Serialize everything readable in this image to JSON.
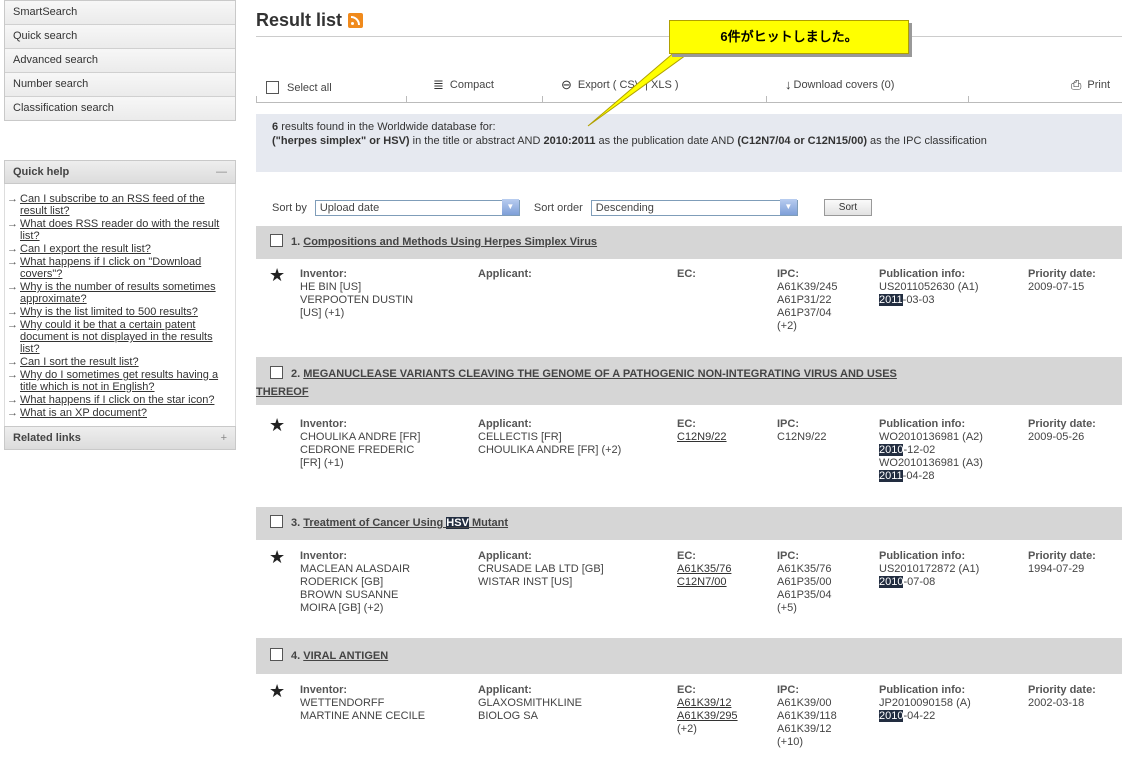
{
  "sidebar": {
    "nav": [
      "SmartSearch",
      "Quick search",
      "Advanced search",
      "Number search",
      "Classification search"
    ],
    "quick_help_title": "Quick help",
    "quick_help_toggle": "—",
    "help_links": [
      "Can I subscribe to an RSS feed of the result list?",
      "What does RSS reader do with the result list?",
      "Can I export the result list?",
      "What happens if I click on \"Download covers\"?",
      "Why is the number of results sometimes approximate?",
      "Why is the list limited to 500 results?",
      "Why could it be that a certain patent document is not displayed in the results list?",
      "Can I sort the result list?",
      "Why do I sometimes get results having a title which is not in English?",
      "What happens if I click on the star icon?",
      "What is an XP document?"
    ],
    "related_title": "Related links",
    "related_toggle": "+"
  },
  "main": {
    "title": "Result list",
    "rss_icon": "rss-feed-icon",
    "callout": "6件がヒットしました。",
    "toolbar": {
      "select_all": "Select all",
      "compact": "Compact",
      "export": "Export  ( CSV | XLS )",
      "download_covers": "Download covers (0)",
      "print": "Print"
    },
    "summary": {
      "count": "6",
      "line1": "results found in the Worldwide database for:",
      "q1": "(\"herpes simplex\" or HSV)",
      "t1": " in the title or abstract AND ",
      "q2": "2010:2011",
      "t2": " as the publication date AND ",
      "q3": "(C12N7/04 or C12N15/00)",
      "t3": " as the IPC classification"
    },
    "sort": {
      "sort_by_label": "Sort by",
      "sort_by_value": "Upload date",
      "sort_order_label": "Sort order",
      "sort_order_value": "Descending",
      "sort_button": "Sort"
    },
    "labels": {
      "inventor": "Inventor:",
      "applicant": "Applicant:",
      "ec": "EC:",
      "ipc": "IPC:",
      "pub": "Publication info:",
      "priority": "Priority date:"
    },
    "results": [
      {
        "num": "1.",
        "title": "Compositions and Methods Using Herpes Simplex Virus",
        "inventor": [
          "HE BIN [US]",
          "VERPOOTEN DUSTIN",
          "[US] (+1)"
        ],
        "applicant": [],
        "ec": [],
        "ipc": [
          "A61K39/245",
          "A61P31/22",
          "A61P37/04",
          "(+2)"
        ],
        "pub": [
          {
            "doc": "US2011052630 (A1)",
            "year": "2011",
            "rest": "-03-03"
          }
        ],
        "priority": "2009-07-15"
      },
      {
        "num": "2.",
        "title_a": "MEGANUCLEASE VARIANTS CLEAVING THE GENOME OF A PATHOGENIC NON-INTEGRATING VIRUS AND USES",
        "title_b": "THEREOF",
        "inventor": [
          "CHOULIKA ANDRE [FR]",
          "CEDRONE FREDERIC",
          "[FR] (+1)"
        ],
        "applicant": [
          "CELLECTIS [FR]",
          "CHOULIKA ANDRE [FR] (+2)"
        ],
        "ec": [
          "C12N9/22"
        ],
        "ipc": [
          "C12N9/22"
        ],
        "pub": [
          {
            "doc": "WO2010136981 (A2)",
            "year": "2010",
            "rest": "-12-02"
          },
          {
            "doc": "WO2010136981 (A3)",
            "year": "2011",
            "rest": "-04-28"
          }
        ],
        "priority": "2009-05-26"
      },
      {
        "num": "3.",
        "title_pre": "Treatment of Cancer Using ",
        "title_hl": "HSV",
        "title_post": " Mutant",
        "inventor": [
          "MACLEAN ALASDAIR",
          "RODERICK [GB]",
          "BROWN SUSANNE",
          "MOIRA [GB] (+2)"
        ],
        "applicant": [
          "CRUSADE LAB LTD [GB]",
          "WISTAR INST [US]"
        ],
        "ec": [
          "A61K35/76",
          "C12N7/00"
        ],
        "ipc": [
          "A61K35/76",
          "A61P35/00",
          "A61P35/04",
          "(+5)"
        ],
        "pub": [
          {
            "doc": "US2010172872 (A1)",
            "year": "2010",
            "rest": "-07-08"
          }
        ],
        "priority": "1994-07-29"
      },
      {
        "num": "4.",
        "title": "VIRAL ANTIGEN",
        "inventor": [
          "WETTENDORFF",
          "MARTINE ANNE CECILE"
        ],
        "applicant": [
          "GLAXOSMITHKLINE",
          "BIOLOG SA"
        ],
        "ec": [
          "A61K39/12",
          "A61K39/295",
          "(+2)"
        ],
        "ipc": [
          "A61K39/00",
          "A61K39/118",
          "A61K39/12",
          "(+10)"
        ],
        "pub": [
          {
            "doc": "JP2010090158 (A)",
            "year": "2010",
            "rest": "-04-22"
          }
        ],
        "priority": "2002-03-18"
      }
    ]
  }
}
